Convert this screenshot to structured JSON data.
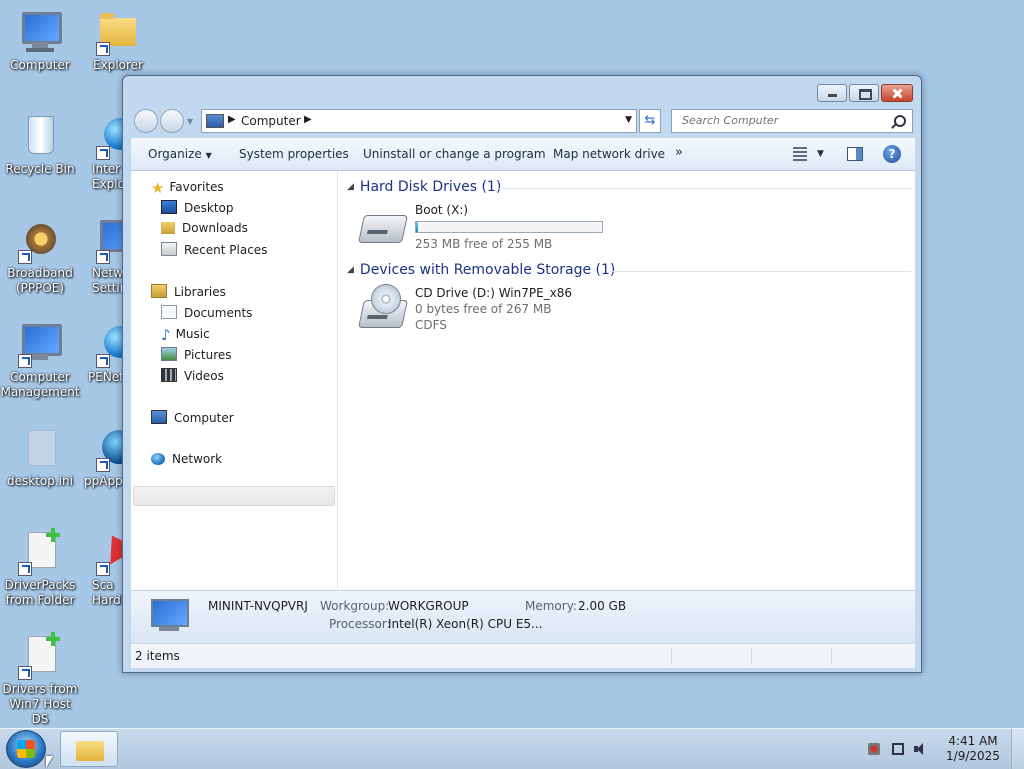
{
  "desktop": {
    "icons": [
      {
        "label": "Computer",
        "icon": "computer-icon"
      },
      {
        "label": "Explorer",
        "icon": "folder-icon"
      },
      {
        "label": "Recycle Bin",
        "icon": "recycle-bin-icon"
      },
      {
        "label": "Inter Explor",
        "icon": "internet-explorer-icon"
      },
      {
        "label": "Broadband (PPPOE)",
        "icon": "broadband-icon"
      },
      {
        "label": "Netw Settin",
        "icon": "network-settings-icon"
      },
      {
        "label": "Computer Management",
        "icon": "computer-management-icon"
      },
      {
        "label": "PENet",
        "icon": "penet-icon"
      },
      {
        "label": "desktop.ini",
        "icon": "settings-file-icon"
      },
      {
        "label": "ppApps",
        "icon": "ppapps-icon"
      },
      {
        "label": "DriverPacks from Folder",
        "icon": "driverpacks-icon"
      },
      {
        "label": "Sca Hard",
        "icon": "scan-hardware-icon"
      },
      {
        "label": "Drivers from Win7 Host DS",
        "icon": "drivers-icon"
      }
    ]
  },
  "window": {
    "address": {
      "segment": "Computer"
    },
    "search": {
      "placeholder": "Search Computer"
    },
    "toolbar": {
      "organize": "Organize",
      "system_properties": "System properties",
      "uninstall": "Uninstall or change a program",
      "map_drive": "Map network drive",
      "more": "»"
    },
    "navpane": {
      "favorites": "Favorites",
      "desktop": "Desktop",
      "downloads": "Downloads",
      "recent": "Recent Places",
      "libraries": "Libraries",
      "documents": "Documents",
      "music": "Music",
      "pictures": "Pictures",
      "videos": "Videos",
      "computer": "Computer",
      "network": "Network"
    },
    "groups": {
      "hdd": {
        "header": "Hard Disk Drives (1)",
        "drive_name": "Boot (X:)",
        "free": "253 MB free of 255 MB",
        "used_fraction": 0.008
      },
      "removable": {
        "header": "Devices with Removable Storage (1)",
        "drive_name": "CD Drive (D:) Win7PE_x86",
        "free": "0 bytes free of 267 MB",
        "fs": "CDFS"
      }
    },
    "details": {
      "computer_name": "MININT-NVQPVRJ",
      "workgroup_label": "Workgroup:",
      "workgroup": "WORKGROUP",
      "memory_label": "Memory:",
      "memory": "2.00 GB",
      "processor_label": "Processor:",
      "processor": "Intel(R) Xeon(R) CPU E5..."
    },
    "status": {
      "items": "2 items"
    }
  },
  "taskbar": {
    "time": "4:41 AM",
    "date": "1/9/2025"
  }
}
